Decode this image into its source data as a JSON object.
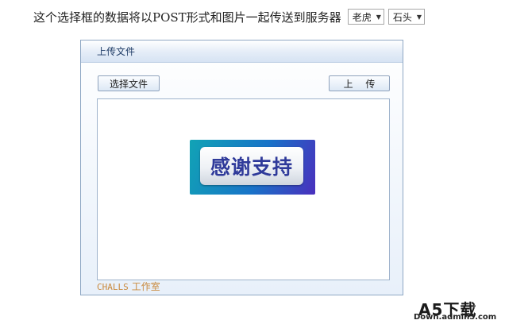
{
  "header": {
    "description": "这个选择框的数据将以POST形式和图片一起传送到服务器",
    "select1": {
      "selected": "老虎"
    },
    "select2": {
      "selected": "石头"
    }
  },
  "panel": {
    "title": "上传文件",
    "choose_button": "选择文件",
    "upload_button": "上 传",
    "preview_image_text": "感谢支持",
    "footer_brand": "CHALLS",
    "footer_studio": "工作室"
  },
  "watermark": {
    "logo": "A5下载",
    "url": "Down.admin5.com"
  },
  "colors": {
    "panel_border": "#8fa8c4",
    "footer_text": "#c98a3e",
    "image_gradient_start": "#11a3b5",
    "image_gradient_end": "#4a2fbd",
    "image_text": "#2f3a9a"
  }
}
